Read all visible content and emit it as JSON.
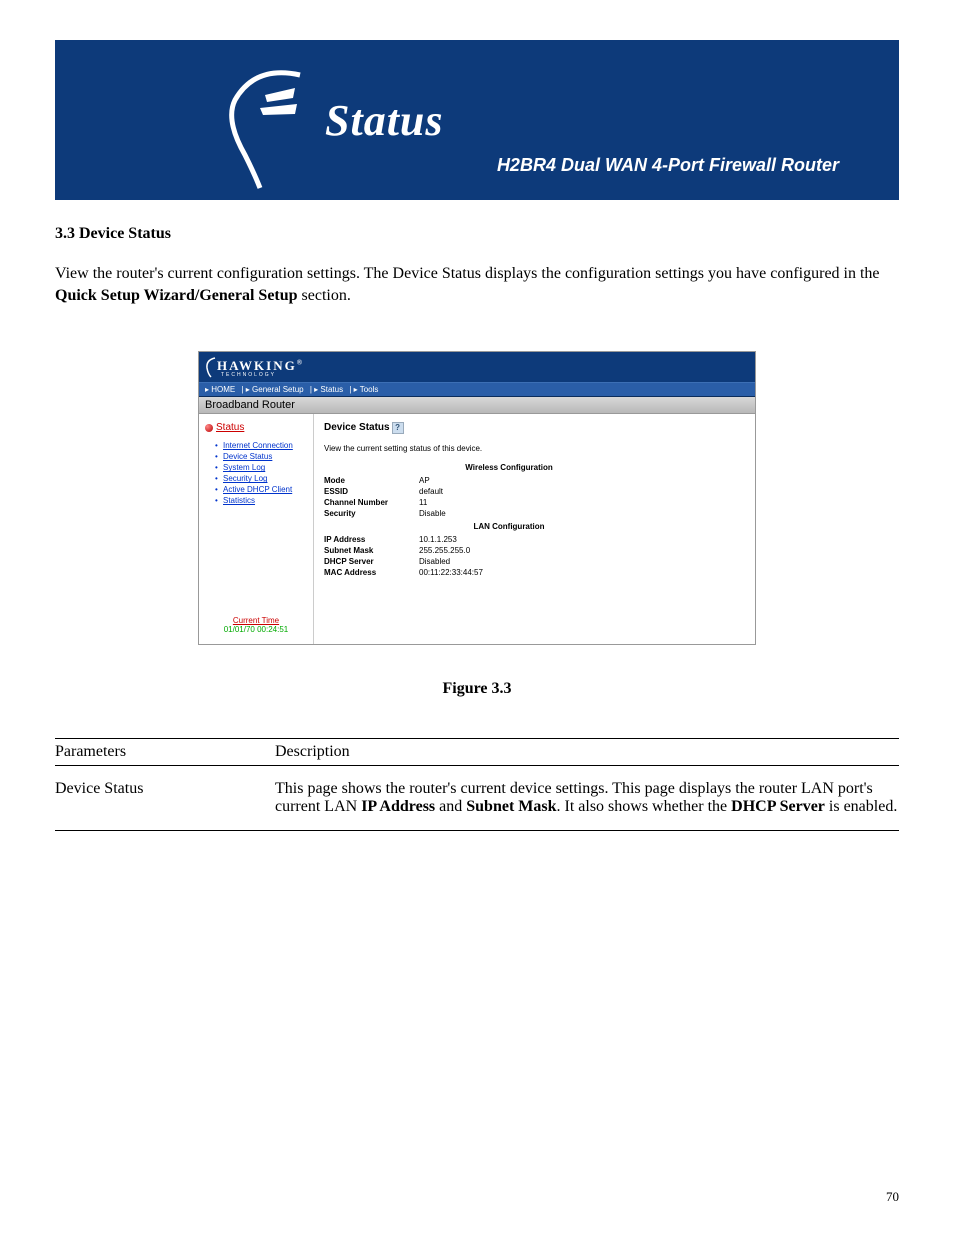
{
  "banner": {
    "title": "Status",
    "product": "H2BR4  Dual WAN 4-Port Firewall Router"
  },
  "section": {
    "heading": "3.3 Device Status",
    "para_1": "View the router's current configuration settings.  The Device Status displays the configuration settings you have configured in the ",
    "para_bold": "Quick Setup Wizard/General Setup",
    "para_2": " section."
  },
  "router": {
    "logo": "HAWKING",
    "logo_sub": "TECHNOLOGY",
    "nav": [
      "HOME",
      "General Setup",
      "Status",
      "Tools"
    ],
    "bar": "Broadband Router",
    "side_title": "Status",
    "side_items": [
      "Internet Connection",
      "Device Status",
      "System Log",
      "Security Log",
      "Active DHCP Client",
      "Statistics"
    ],
    "current_time_label": "Current Time",
    "current_time_value": "01/01/70 00:24:51",
    "main_title": "Device Status",
    "main_desc": "View the current setting status of this device.",
    "group1": "Wireless Configuration",
    "rows1": [
      {
        "k": "Mode",
        "v": "AP"
      },
      {
        "k": "ESSID",
        "v": "default"
      },
      {
        "k": "Channel Number",
        "v": "11"
      },
      {
        "k": "Security",
        "v": "Disable"
      }
    ],
    "group2": "LAN Configuration",
    "rows2": [
      {
        "k": "IP Address",
        "v": "10.1.1.253"
      },
      {
        "k": "Subnet Mask",
        "v": "255.255.255.0"
      },
      {
        "k": "DHCP Server",
        "v": "Disabled"
      },
      {
        "k": "MAC Address",
        "v": "00:11:22:33:44:57"
      }
    ]
  },
  "figure_caption": "Figure 3.3",
  "table": {
    "h1": "Parameters",
    "h2": "Description",
    "r1c1": "Device Status",
    "r1c2_a": "This page shows the router's current device settings.  This page displays the router LAN port's current LAN ",
    "r1c2_b1": "IP Address",
    "r1c2_c": " and ",
    "r1c2_b2": "Subnet Mask",
    "r1c2_d": ".  It also shows whether the ",
    "r1c2_b3": "DHCP Server",
    "r1c2_e": " is enabled."
  },
  "page_number": "70"
}
